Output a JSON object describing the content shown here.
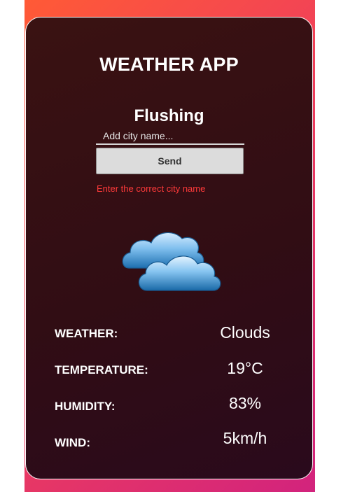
{
  "app": {
    "title": "WEATHER APP"
  },
  "search": {
    "city": "Flushing",
    "placeholder": "Add city name...",
    "send_label": "Send",
    "error": "Enter the correct city name"
  },
  "current": {
    "icon": "clouds-icon",
    "rows": [
      {
        "label": "WEATHER:",
        "value": "Clouds"
      },
      {
        "label": "TEMPERATURE:",
        "value": "19°C"
      },
      {
        "label": "HUMIDITY:",
        "value": "83%"
      },
      {
        "label": "WIND:",
        "value": "5km/h"
      }
    ]
  },
  "colors": {
    "card_background": "#310d14",
    "error_text": "#ff3a3a",
    "gradient_start": "#ff5a36",
    "gradient_end": "#d2237d"
  }
}
